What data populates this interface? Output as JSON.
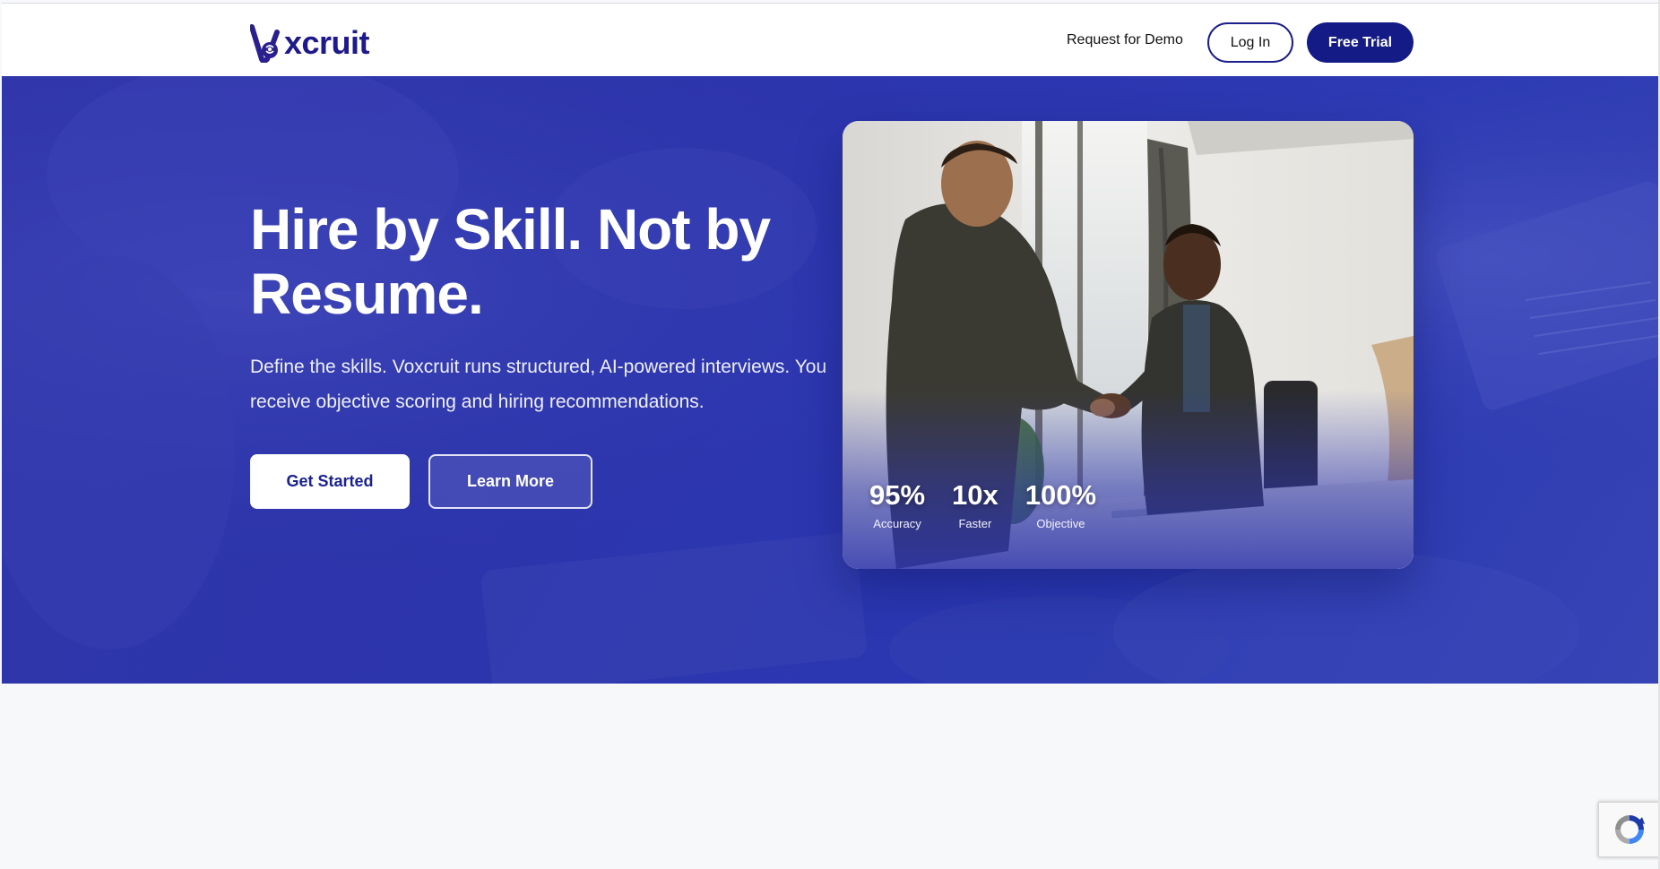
{
  "header": {
    "logo_text": "xcruit",
    "nav": {
      "demo_label": "Request for Demo",
      "login_label": "Log In",
      "trial_label": "Free Trial"
    }
  },
  "hero": {
    "headline": "Hire by Skill. Not by Resume.",
    "subtext": "Define the skills. Voxcruit runs structured, AI-powered interviews. You receive objective scoring and hiring recommendations.",
    "primary_cta": "Get Started",
    "secondary_cta": "Learn More",
    "stats": [
      {
        "value": "95%",
        "label": "Accuracy"
      },
      {
        "value": "10x",
        "label": "Faster"
      },
      {
        "value": "100%",
        "label": "Objective"
      }
    ]
  },
  "colors": {
    "brand": "#1f1a8c",
    "hero_bg": "#2d35ad",
    "page_bg": "#f7f8fa"
  },
  "icons": {
    "logo": "voxcruit-logo-mark",
    "recaptcha": "recaptcha-icon"
  }
}
